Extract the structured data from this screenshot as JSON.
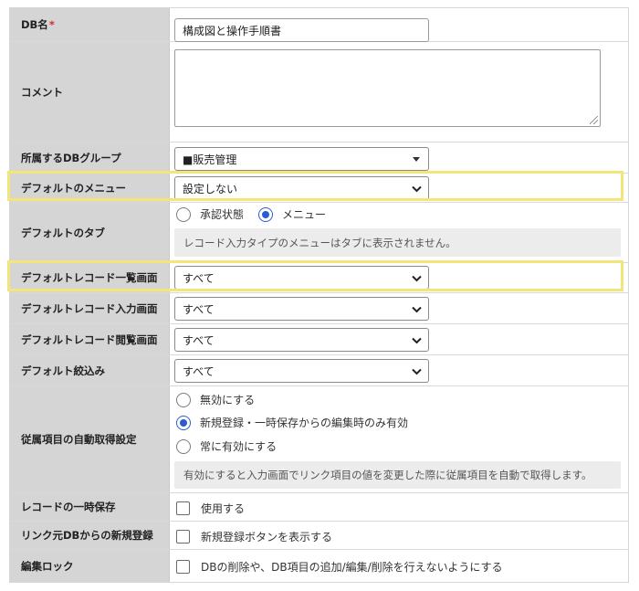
{
  "rows": {
    "db_name": {
      "label": "DB名",
      "required_mark": "*",
      "value": "構成図と操作手順書"
    },
    "comment": {
      "label": "コメント",
      "value": ""
    },
    "group": {
      "label": "所属するDBグループ",
      "selected": "■販売管理"
    },
    "default_menu": {
      "label": "デフォルトのメニュー",
      "selected": "設定しない"
    },
    "default_tab": {
      "label": "デフォルトのタブ",
      "options": [
        {
          "label": "承認状態",
          "checked": false
        },
        {
          "label": "メニュー",
          "checked": true
        }
      ],
      "note": "レコード入力タイプのメニューはタブに表示されません。"
    },
    "default_list": {
      "label": "デフォルトレコード一覧画面",
      "selected": "すべて"
    },
    "default_input": {
      "label": "デフォルトレコード入力画面",
      "selected": "すべて"
    },
    "default_view": {
      "label": "デフォルトレコード閲覧画面",
      "selected": "すべて"
    },
    "default_filter": {
      "label": "デフォルト絞込み",
      "selected": "すべて"
    },
    "auto_fetch": {
      "label": "従属項目の自動取得設定",
      "options": [
        {
          "label": "無効にする",
          "checked": false
        },
        {
          "label": "新規登録・一時保存からの編集時のみ有効",
          "checked": true
        },
        {
          "label": "常に有効にする",
          "checked": false
        }
      ],
      "note": "有効にすると入力画面でリンク項目の値を変更した際に従属項目を自動で取得します。"
    },
    "temp_save": {
      "label": "レコードの一時保存",
      "checkbox_label": "使用する",
      "checked": false
    },
    "link_new": {
      "label": "リンク元DBからの新規登録",
      "checkbox_label": "新規登録ボタンを表示する",
      "checked": false
    },
    "edit_lock": {
      "label": "編集ロック",
      "checkbox_label": "DBの削除や、DB項目の追加/編集/削除を行えないようにする",
      "checked": false
    }
  },
  "colors": {
    "label_bg": "#d5d5d5",
    "highlight": "#f4e57a",
    "radio_on": "#2a5bd7",
    "required": "#d0312d"
  }
}
